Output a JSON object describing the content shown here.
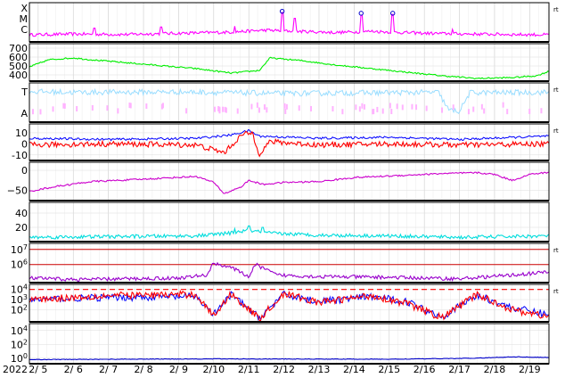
{
  "chart_data": {
    "type": "line",
    "x_axis": {
      "year_label": "2022",
      "date_labels": [
        "2/ 5",
        "2/ 6",
        "2/ 7",
        "2/ 8",
        "2/ 9",
        "2/10",
        "2/11",
        "2/12",
        "2/13",
        "2/14",
        "2/15",
        "2/16",
        "2/17",
        "2/18",
        "2/19"
      ],
      "start_day": 4.75,
      "end_day": 19.55,
      "grid": true
    },
    "panels": [
      {
        "id": "flare",
        "yticks": [
          "X",
          "M",
          "C"
        ],
        "side_mark": "rt",
        "series": [
          {
            "color": "#ff00ff",
            "profile": [
              [
                4.75,
                0.18
              ],
              [
                6.0,
                0.2
              ],
              [
                7.5,
                0.19
              ],
              [
                9.0,
                0.22
              ],
              [
                10.5,
                0.25
              ],
              [
                11.5,
                0.3
              ],
              [
                12.0,
                0.28
              ],
              [
                13.5,
                0.24
              ],
              [
                14.5,
                0.27
              ],
              [
                16.0,
                0.22
              ],
              [
                17.5,
                0.2
              ],
              [
                19.55,
                0.18
              ]
            ],
            "noise": 0.04,
            "spikes": [
              [
                11.95,
                0.75
              ],
              [
                12.3,
                0.6
              ],
              [
                14.2,
                0.68
              ],
              [
                15.1,
                0.7
              ],
              [
                6.6,
                0.35
              ],
              [
                8.5,
                0.38
              ],
              [
                10.6,
                0.4
              ],
              [
                16.8,
                0.32
              ]
            ]
          }
        ],
        "markers": [
          {
            "day": 11.95,
            "level": 0.78
          },
          {
            "day": 14.2,
            "level": 0.73
          },
          {
            "day": 15.1,
            "level": 0.73
          }
        ]
      },
      {
        "id": "wind-speed",
        "yticks": [
          {
            "value": 700,
            "label": "700"
          },
          {
            "value": 600,
            "label": "600"
          },
          {
            "value": 500,
            "label": "500"
          },
          {
            "value": 400,
            "label": "400"
          }
        ],
        "ylim": [
          330,
          750
        ],
        "series": [
          {
            "color": "#00ee00",
            "profile": [
              [
                4.75,
                490
              ],
              [
                5.3,
                570
              ],
              [
                6.0,
                590
              ],
              [
                6.5,
                570
              ],
              [
                8.0,
                520
              ],
              [
                9.5,
                470
              ],
              [
                10.5,
                420
              ],
              [
                11.3,
                450
              ],
              [
                11.6,
                590
              ],
              [
                12.5,
                560
              ],
              [
                13.5,
                510
              ],
              [
                14.5,
                470
              ],
              [
                15.5,
                430
              ],
              [
                16.5,
                390
              ],
              [
                17.5,
                360
              ],
              [
                18.5,
                370
              ],
              [
                19.2,
                390
              ],
              [
                19.55,
                440
              ]
            ],
            "noise": 8,
            "spikes": []
          }
        ]
      },
      {
        "id": "temperature-dir",
        "yticks": [
          "T",
          "A"
        ],
        "side_mark": "rt",
        "series": [
          {
            "color": "#99ddff",
            "profile": [
              [
                4.75,
                0.78
              ],
              [
                6.0,
                0.76
              ],
              [
                9.0,
                0.77
              ],
              [
                10.5,
                0.75
              ],
              [
                12.0,
                0.73
              ],
              [
                14.5,
                0.75
              ],
              [
                16.4,
                0.76
              ],
              [
                16.7,
                0.3
              ],
              [
                17.0,
                0.28
              ],
              [
                17.3,
                0.75
              ],
              [
                19.55,
                0.76
              ]
            ],
            "noise": 0.07,
            "spikes": []
          },
          {
            "color": "#ffb3ff",
            "profile": [
              [
                4.75,
                0.35
              ],
              [
                19.55,
                0.35
              ]
            ],
            "noise": 0.18,
            "spikes": [],
            "scatter": true
          }
        ]
      },
      {
        "id": "imf",
        "yticks": [
          {
            "value": 10,
            "label": "10"
          },
          {
            "value": 0,
            "label": "0"
          },
          {
            "value": -10,
            "label": "-10"
          }
        ],
        "ylim": [
          -15,
          18
        ],
        "side_mark": "rt",
        "series": [
          {
            "color": "#0000ff",
            "profile": [
              [
                4.75,
                5
              ],
              [
                7.0,
                4
              ],
              [
                9.5,
                5
              ],
              [
                10.5,
                8
              ],
              [
                11.0,
                12
              ],
              [
                11.3,
                7
              ],
              [
                13.0,
                5
              ],
              [
                15.0,
                6
              ],
              [
                17.0,
                4
              ],
              [
                19.55,
                7
              ]
            ],
            "noise": 1.0,
            "spikes": []
          },
          {
            "color": "#ff0000",
            "profile": [
              [
                4.75,
                -1
              ],
              [
                7.0,
                0
              ],
              [
                9.5,
                -1
              ],
              [
                10.3,
                -8
              ],
              [
                10.8,
                8
              ],
              [
                11.1,
                10
              ],
              [
                11.3,
                -9
              ],
              [
                11.6,
                2
              ],
              [
                13.0,
                -1
              ],
              [
                15.0,
                0
              ],
              [
                17.0,
                -1
              ],
              [
                19.55,
                0
              ]
            ],
            "noise": 2.5,
            "spikes": []
          }
        ]
      },
      {
        "id": "dst",
        "yticks": [
          {
            "value": 0,
            "label": "0"
          },
          {
            "value": -50,
            "label": "−50"
          }
        ],
        "ylim": [
          -75,
          20
        ],
        "series": [
          {
            "color": "#cc00cc",
            "profile": [
              [
                4.75,
                -52
              ],
              [
                5.5,
                -40
              ],
              [
                6.5,
                -28
              ],
              [
                8.0,
                -22
              ],
              [
                9.5,
                -15
              ],
              [
                10.0,
                -30
              ],
              [
                10.3,
                -58
              ],
              [
                10.8,
                -40
              ],
              [
                11.0,
                -25
              ],
              [
                11.4,
                -35
              ],
              [
                12.0,
                -30
              ],
              [
                13.0,
                -28
              ],
              [
                14.0,
                -18
              ],
              [
                15.5,
                -12
              ],
              [
                16.5,
                -8
              ],
              [
                17.5,
                -6
              ],
              [
                18.0,
                -10
              ],
              [
                18.5,
                -25
              ],
              [
                19.0,
                -10
              ],
              [
                19.55,
                -5
              ]
            ],
            "noise": 2,
            "spikes": []
          }
        ]
      },
      {
        "id": "kp",
        "yticks": [
          {
            "value": 40,
            "label": "40"
          },
          {
            "value": 20,
            "label": "20"
          }
        ],
        "ylim": [
          0,
          55
        ],
        "series": [
          {
            "color": "#00dddd",
            "profile": [
              [
                4.75,
                6
              ],
              [
                7.0,
                7
              ],
              [
                9.5,
                8
              ],
              [
                10.5,
                12
              ],
              [
                11.0,
                16
              ],
              [
                11.5,
                12
              ],
              [
                13.0,
                9
              ],
              [
                15.0,
                8
              ],
              [
                17.0,
                6
              ],
              [
                19.55,
                8
              ]
            ],
            "noise": 2.5,
            "spikes": [
              [
                11.0,
                22
              ],
              [
                11.4,
                20
              ],
              [
                10.6,
                18
              ]
            ]
          }
        ]
      },
      {
        "id": "electron",
        "yticks": [
          {
            "value": 7,
            "label": "10^7"
          },
          {
            "value": 6,
            "label": "10^6"
          }
        ],
        "ylim": [
          4.8,
          7.4
        ],
        "side_mark": "rt",
        "reference_lines": [
          {
            "value": 7,
            "color": "#cc0000"
          },
          {
            "value": 6,
            "color": "#cc0000"
          }
        ],
        "series": [
          {
            "color": "#9900cc",
            "profile": [
              [
                4.75,
                5.1
              ],
              [
                6.0,
                5.0
              ],
              [
                9.0,
                5.1
              ],
              [
                9.8,
                5.3
              ],
              [
                10.0,
                6.1
              ],
              [
                10.5,
                5.8
              ],
              [
                11.0,
                5.2
              ],
              [
                11.2,
                6.0
              ],
              [
                11.8,
                5.3
              ],
              [
                13.0,
                5.2
              ],
              [
                15.0,
                5.15
              ],
              [
                17.0,
                5.05
              ],
              [
                18.5,
                5.3
              ],
              [
                19.55,
                5.5
              ]
            ],
            "noise": 0.12,
            "spikes": []
          }
        ]
      },
      {
        "id": "proton",
        "yticks": [
          {
            "value": 4,
            "label": "10^4"
          },
          {
            "value": 3,
            "label": "10^3"
          },
          {
            "value": 2,
            "label": "10^2"
          }
        ],
        "ylim": [
          0.8,
          4.5
        ],
        "side_mark": "rt",
        "reference_lines": [
          {
            "value": 4,
            "color": "#ff0000",
            "dashed": true
          }
        ],
        "series": [
          {
            "color": "#0000ff",
            "profile": [
              [
                4.75,
                3.0
              ],
              [
                7.0,
                3.2
              ],
              [
                9.5,
                3.3
              ],
              [
                10.0,
                1.5
              ],
              [
                10.5,
                3.5
              ],
              [
                11.3,
                1.2
              ],
              [
                12.0,
                3.5
              ],
              [
                13.0,
                2.8
              ],
              [
                14.5,
                3.3
              ],
              [
                15.5,
                2.8
              ],
              [
                16.5,
                1.3
              ],
              [
                17.5,
                3.4
              ],
              [
                18.5,
                2.2
              ],
              [
                19.55,
                1.5
              ]
            ],
            "noise": 0.35,
            "spikes": []
          },
          {
            "color": "#ff0000",
            "profile": [
              [
                4.75,
                3.0
              ],
              [
                7.0,
                3.4
              ],
              [
                9.5,
                3.5
              ],
              [
                10.0,
                1.4
              ],
              [
                10.5,
                3.6
              ],
              [
                11.3,
                1.1
              ],
              [
                12.0,
                3.6
              ],
              [
                13.0,
                2.7
              ],
              [
                14.5,
                3.4
              ],
              [
                15.5,
                2.6
              ],
              [
                16.5,
                1.2
              ],
              [
                17.5,
                3.5
              ],
              [
                18.5,
                2.0
              ],
              [
                19.55,
                1.3
              ]
            ],
            "noise": 0.35,
            "spikes": []
          }
        ]
      },
      {
        "id": "xray",
        "yticks": [
          {
            "value": 4,
            "label": "10^4"
          },
          {
            "value": 2,
            "label": "10^2"
          },
          {
            "value": 0,
            "label": "10^0"
          }
        ],
        "ylim": [
          -0.8,
          5.0
        ],
        "series": [
          {
            "color": "#0000cc",
            "profile": [
              [
                4.75,
                -0.2
              ],
              [
                10.0,
                -0.1
              ],
              [
                15.0,
                -0.15
              ],
              [
                17.5,
                0.0
              ],
              [
                18.5,
                0.2
              ],
              [
                19.55,
                0.1
              ]
            ],
            "noise": 0.04,
            "spikes": []
          }
        ]
      }
    ]
  }
}
